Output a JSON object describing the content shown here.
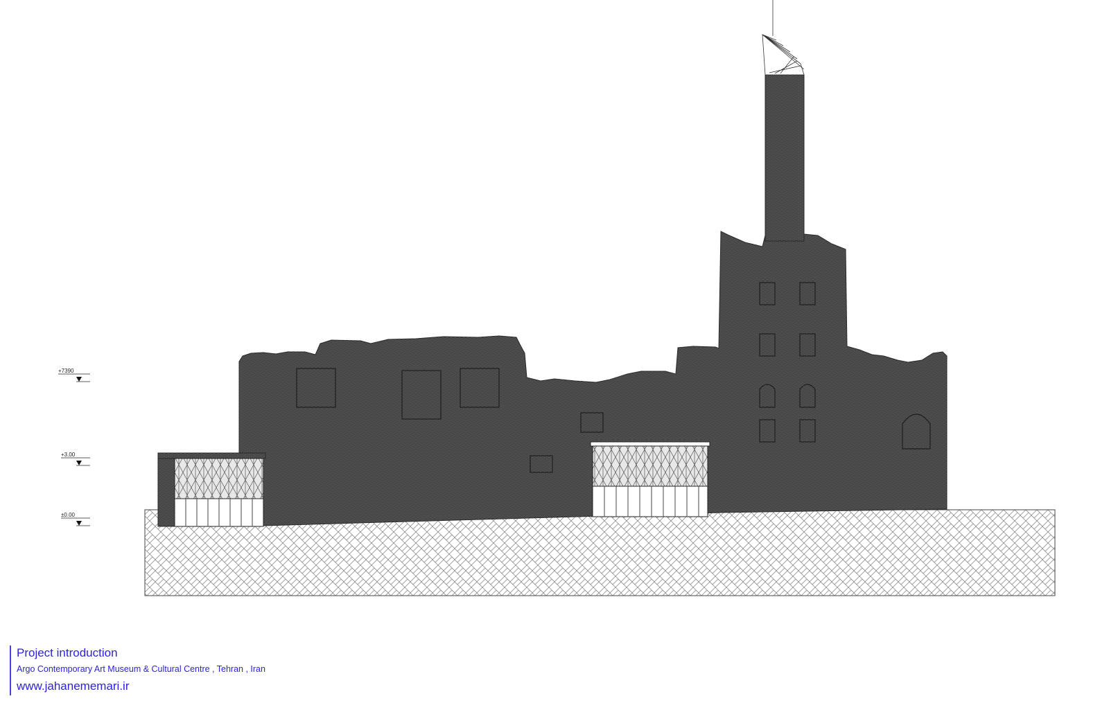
{
  "levels": [
    {
      "label": "+7390"
    },
    {
      "label": "+3.00"
    },
    {
      "label": "±0.00"
    }
  ],
  "caption": {
    "title": "Project introduction",
    "subtitle": "Argo Contemporary Art Museum & Cultural Centre , Tehran , Iran",
    "url": "www.jahanememari.ir"
  },
  "colors": {
    "wall": "#5c5c5c",
    "caption": "#2d22d9"
  }
}
